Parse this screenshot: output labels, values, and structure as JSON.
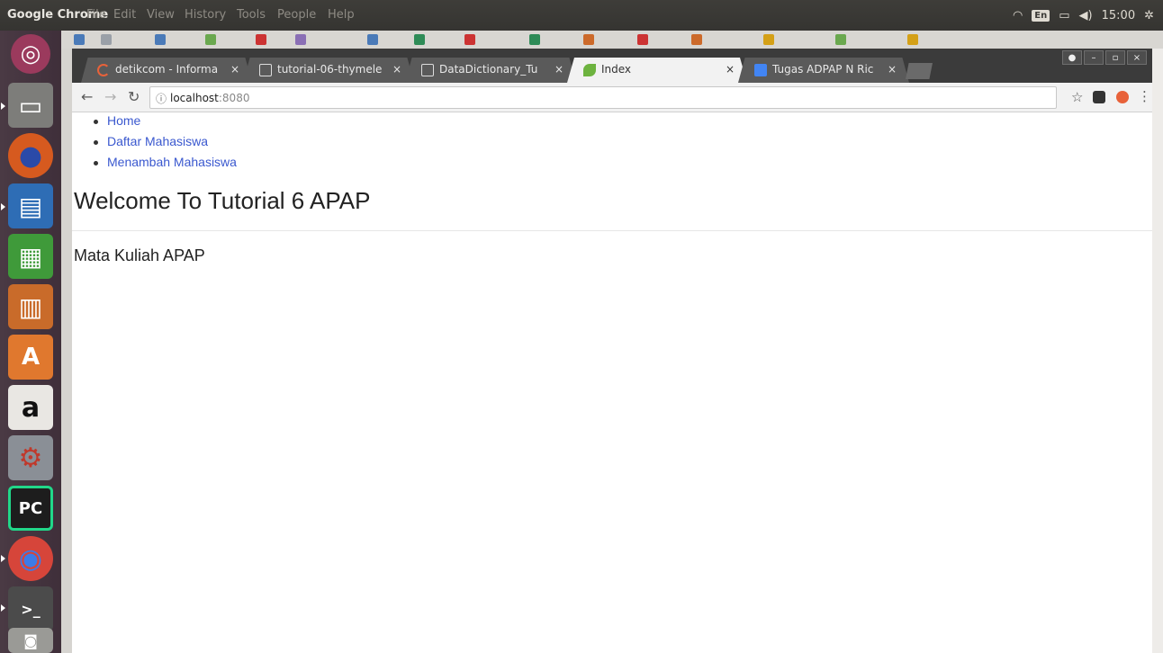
{
  "os": {
    "app_title": "Google Chrome",
    "menu": [
      "File",
      "Edit",
      "View",
      "History",
      "Tools",
      "People",
      "Help"
    ],
    "keyboard_layout": "En",
    "clock": "15:00"
  },
  "launcher": [
    {
      "name": "ubuntu-dash-icon",
      "glyph": "◎"
    },
    {
      "name": "files-icon",
      "glyph": "▭"
    },
    {
      "name": "firefox-icon",
      "glyph": "●"
    },
    {
      "name": "writer-icon",
      "glyph": "▤"
    },
    {
      "name": "calc-icon",
      "glyph": "▦"
    },
    {
      "name": "impress-icon",
      "glyph": "▥"
    },
    {
      "name": "software-center-icon",
      "glyph": "A"
    },
    {
      "name": "amazon-icon",
      "glyph": "a"
    },
    {
      "name": "system-settings-icon",
      "glyph": "⚙"
    },
    {
      "name": "pycharm-icon",
      "glyph": "PC"
    },
    {
      "name": "chrome-icon",
      "glyph": "◉"
    },
    {
      "name": "terminal-icon",
      "glyph": ">_"
    },
    {
      "name": "disk-icon",
      "glyph": "◙"
    }
  ],
  "tabs": [
    {
      "label": "detikcom - Informa",
      "active": false
    },
    {
      "label": "tutorial-06-thymele",
      "active": false
    },
    {
      "label": "DataDictionary_Tu",
      "active": false
    },
    {
      "label": "Index",
      "active": true
    },
    {
      "label": "Tugas ADPAP N Ric",
      "active": false
    }
  ],
  "address": {
    "host": "localhost",
    "port": ":8080"
  },
  "page": {
    "nav": [
      "Home",
      "Daftar Mahasiswa",
      "Menambah Mahasiswa"
    ],
    "heading": "Welcome To Tutorial 6 APAP",
    "subtitle": "Mata Kuliah APAP"
  },
  "colors": {
    "link": "#3a58cf",
    "tabstrip": "#3b3b3b",
    "launcher": "#4a3a44"
  }
}
